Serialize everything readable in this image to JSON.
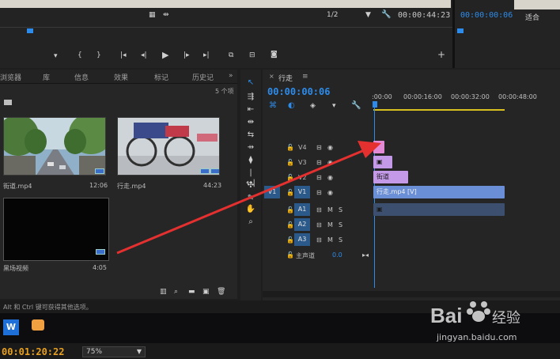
{
  "monitor": {
    "page_indicator": "1/2",
    "timecode_right": "00:00:44:23",
    "timecode_source": "00:00:00:06",
    "zoom_label": "适合"
  },
  "project": {
    "tabs": [
      "浏览器",
      "库",
      "信息",
      "效果",
      "标记",
      "历史记"
    ],
    "item_count": "5 个项",
    "items": [
      {
        "name": "街道.mp4",
        "duration": "12:06"
      },
      {
        "name": "行走.mp4",
        "duration": "44:23"
      },
      {
        "name": "黑场视频",
        "duration": "4:05"
      }
    ]
  },
  "timeline": {
    "tab_title": "行走",
    "timecode": "00:00:00:06",
    "ruler": [
      ":00:00",
      "00:00:16:00",
      "00:00:32:00",
      "00:00:48:00"
    ],
    "video_tracks": [
      "V4",
      "V3",
      "V2",
      "V1"
    ],
    "audio_tracks": [
      "A1",
      "A2",
      "A3"
    ],
    "source_video": "V1",
    "master_label": "主声道",
    "master_value": "0.0",
    "clip_v2": "街道",
    "clip_v1": "行走.mp4 [V]",
    "m_label": "M",
    "s_label": "S"
  },
  "status_text": "Alt 和 Ctrl 键可获得其他选项。",
  "bottom": {
    "timecode": "00:01:20:22",
    "zoom": "75%"
  },
  "watermark": {
    "brand": "Bai",
    "brand2": "经验",
    "url": "jingyan.baidu.com"
  },
  "colors": {
    "accent_blue": "#2d8ceb",
    "timecode_yellow": "#e8a020",
    "clip_v1": "#6b8fd6",
    "clip_v2": "#c49ae8",
    "clip_v4": "#e28ad6",
    "arrow_red": "#e53030"
  }
}
